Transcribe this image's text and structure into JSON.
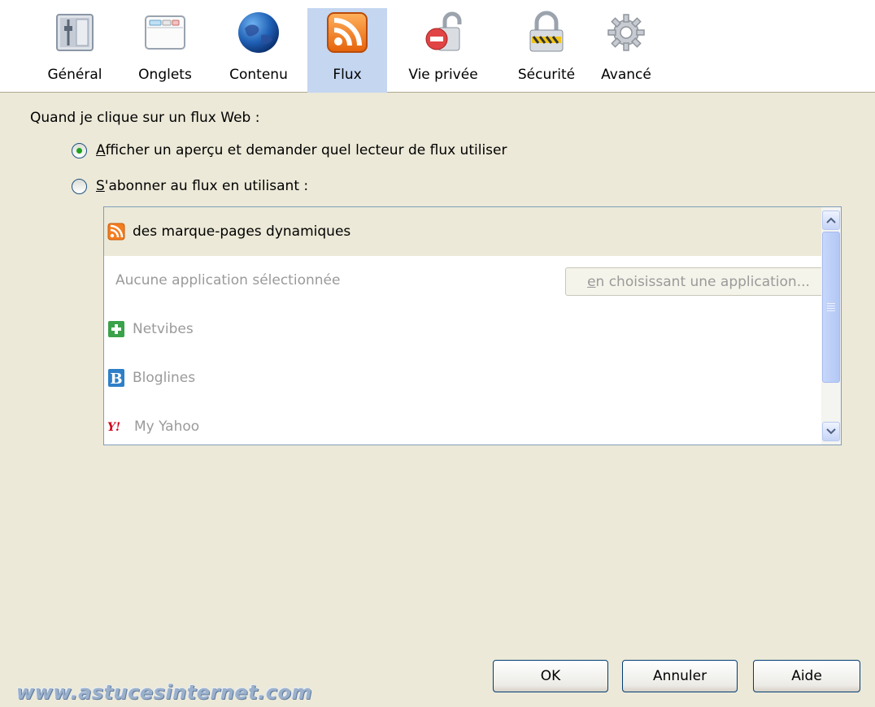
{
  "toolbar": {
    "tabs": [
      {
        "label": "Général",
        "icon": "general-settings-icon"
      },
      {
        "label": "Onglets",
        "icon": "tabs-window-icon"
      },
      {
        "label": "Contenu",
        "icon": "globe-icon"
      },
      {
        "label": "Flux",
        "icon": "rss-feed-icon",
        "selected": true
      },
      {
        "label": "Vie privée",
        "icon": "privacy-lock-icon"
      },
      {
        "label": "Sécurité",
        "icon": "security-padlock-icon"
      },
      {
        "label": "Avancé",
        "icon": "gear-icon"
      }
    ]
  },
  "feeds": {
    "heading": "Quand je clique sur un flux Web :",
    "option_preview": {
      "accesskey": "A",
      "rest": "fficher un aperçu et demander quel lecteur de flux utiliser",
      "checked": true
    },
    "option_subscribe": {
      "accesskey": "S",
      "rest": "'abonner au flux en utilisant :",
      "checked": false
    },
    "readers": [
      {
        "label": "des marque-pages dynamiques",
        "icon": "rss-feed-icon"
      },
      {
        "label": "Aucune application sélectionnée"
      },
      {
        "label": "Netvibes",
        "icon": "netvibes-icon"
      },
      {
        "label": "Bloglines",
        "icon": "bloglines-icon"
      },
      {
        "label": "My Yahoo",
        "icon": "yahoo-icon"
      }
    ],
    "choose_app": {
      "accesskey": "e",
      "rest": "n choisissant une application..."
    }
  },
  "buttons": {
    "ok": "OK",
    "cancel": "Annuler",
    "help": "Aide"
  },
  "watermark": "www.astucesinternet.com"
}
